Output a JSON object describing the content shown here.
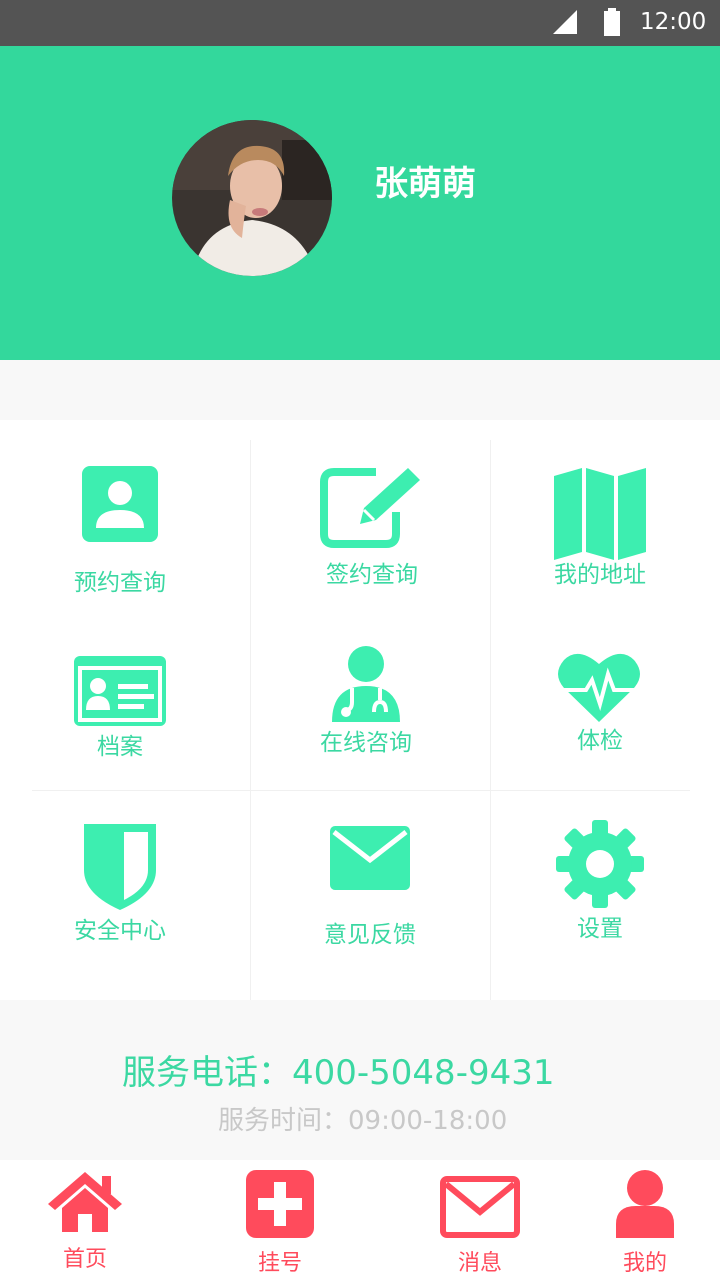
{
  "status_bar": {
    "time": "12:00"
  },
  "profile": {
    "name": "张萌萌"
  },
  "menu_items": [
    {
      "label": "预约查询",
      "icon": "contact-card-icon"
    },
    {
      "label": "签约查询",
      "icon": "edit-pencil-icon"
    },
    {
      "label": "我的地址",
      "icon": "map-icon"
    },
    {
      "label": "档案",
      "icon": "id-card-icon"
    },
    {
      "label": "在线咨询",
      "icon": "doctor-stethoscope-icon"
    },
    {
      "label": "体检",
      "icon": "heartbeat-icon"
    },
    {
      "label": "安全中心",
      "icon": "shield-icon"
    },
    {
      "label": "意见反馈",
      "icon": "envelope-icon"
    },
    {
      "label": "设置",
      "icon": "gear-icon"
    }
  ],
  "service": {
    "phone": "服务电话：400-5048-9431",
    "hours": "服务时间：09:00-18:00"
  },
  "bottom_nav": [
    {
      "label": "首页",
      "icon": "home-icon"
    },
    {
      "label": "挂号",
      "icon": "medical-cross-icon"
    },
    {
      "label": "消息",
      "icon": "message-envelope-icon"
    },
    {
      "label": "我的",
      "icon": "person-icon"
    }
  ],
  "colors": {
    "header_green": "#33d89c",
    "icon_green": "#3deeb0",
    "label_green": "#3bd8a2",
    "nav_red": "#ff4b5c",
    "status_bar": "#545454"
  }
}
